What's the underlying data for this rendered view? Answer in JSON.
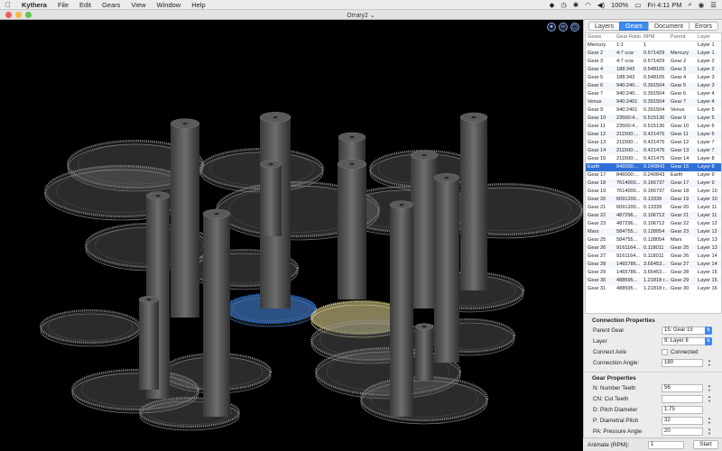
{
  "menubar": {
    "app": "Kythera",
    "items": [
      "File",
      "Edit",
      "Gears",
      "View",
      "Window",
      "Help"
    ],
    "battery": "100%",
    "clock": "Fri 4:11 PM"
  },
  "window": {
    "title": "Orrary2 ⌄"
  },
  "tabs": [
    "Layers",
    "Gears",
    "Document",
    "Errors"
  ],
  "active_tab": "Gears",
  "table": {
    "headers": [
      "Gears",
      "Gear Ratio",
      "RPM",
      "Parent",
      "Layer"
    ],
    "rows": [
      [
        "Mercury",
        "1:1",
        "1",
        "",
        "Layer 1"
      ],
      [
        "Gear 2",
        "4:7 ccw",
        "0.571429",
        "Mercury",
        "Layer 1"
      ],
      [
        "Gear 3",
        "4:7 ccw",
        "0.571429",
        "Gear 2",
        "Layer 2"
      ],
      [
        "Gear 4",
        "188:343",
        "0.548105",
        "Gear 3",
        "Layer 2"
      ],
      [
        "Gear 5",
        "188:343",
        "0.548105",
        "Gear 4",
        "Layer 3"
      ],
      [
        "Gear 6",
        "940:240...",
        "0.391504",
        "Gear 5",
        "Layer 3"
      ],
      [
        "Gear 7",
        "940:240...",
        "0.391504",
        "Gear 6",
        "Layer 4"
      ],
      [
        "Venus",
        "940:2401",
        "0.391504",
        "Gear 7",
        "Layer 4"
      ],
      [
        "Gear 9",
        "940:2401",
        "0.391504",
        "Venus",
        "Layer 5"
      ],
      [
        "Gear 10",
        "23500:4...",
        "0.515136",
        "Gear 9",
        "Layer 5"
      ],
      [
        "Gear 11",
        "23500:4...",
        "0.515136",
        "Gear 10",
        "Layer 6"
      ],
      [
        "Gear 12",
        "211500:...",
        "0.421475",
        "Gear 11",
        "Layer 6"
      ],
      [
        "Gear 13",
        "211500:...",
        "0.421475",
        "Gear 12",
        "Layer 7"
      ],
      [
        "Gear 14",
        "211500:...",
        "0.421475",
        "Gear 13",
        "Layer 7"
      ],
      [
        "Gear 15",
        "211500:...",
        "0.421475",
        "Gear 14",
        "Layer 8"
      ],
      [
        "Earth",
        "846000:...",
        "0.240843",
        "Gear 15",
        "Layer 8"
      ],
      [
        "Gear 17",
        "846000:...",
        "0.240843",
        "Earth",
        "Layer 9"
      ],
      [
        "Gear 18",
        "7614000...",
        "0.166737",
        "Gear 17",
        "Layer 9"
      ],
      [
        "Gear 19",
        "7614000...",
        "0.166737",
        "Gear 18",
        "Layer 10"
      ],
      [
        "Gear 20",
        "6091200...",
        "0.13339",
        "Gear 19",
        "Layer 10"
      ],
      [
        "Gear 21",
        "6091200...",
        "0.13339",
        "Gear 20",
        "Layer 11"
      ],
      [
        "Gear 22",
        "487296...",
        "0.106712",
        "Gear 21",
        "Layer 11"
      ],
      [
        "Gear 23",
        "487296...",
        "0.106712",
        "Gear 22",
        "Layer 12"
      ],
      [
        "Mars",
        "584755...",
        "0.128054",
        "Gear 23",
        "Layer 12"
      ],
      [
        "Gear 25",
        "584755...",
        "0.128054",
        "Mars",
        "Layer 13"
      ],
      [
        "Gear 26",
        "9161164...",
        "0.118011",
        "Gear 25",
        "Layer 13"
      ],
      [
        "Gear 27",
        "9161164...",
        "0.118011",
        "Gear 26",
        "Layer 14"
      ],
      [
        "Gear 28",
        "1465786...",
        "3.65453...",
        "Gear 27",
        "Layer 14"
      ],
      [
        "Gear 29",
        "1465786...",
        "3.65453...",
        "Gear 28",
        "Layer 15"
      ],
      [
        "Gear 30",
        "488595...",
        "1.21818 r...",
        "Gear 29",
        "Layer 15"
      ],
      [
        "Gear 31",
        "488595...",
        "1.21818 r...",
        "Gear 30",
        "Layer 16"
      ]
    ],
    "selected_row": 15
  },
  "connection": {
    "title": "Connection Properties",
    "parent_gear_label": "Parent Gear",
    "parent_gear_value": "15: Gear 15",
    "layer_label": "Layer",
    "layer_value": "9: Layer 8",
    "connect_axle_label": "Connect Axle",
    "connected_label": "Connected",
    "angle_label": "Connection Angle:",
    "angle_value": "180"
  },
  "gear": {
    "title": "Gear Properties",
    "teeth_label": "N: Number Teeth",
    "teeth_value": "56",
    "cut_teeth_label": "CN: Cut Teeth",
    "cut_teeth_value": "",
    "pitch_diameter_label": "D: Pitch Diameter",
    "pitch_diameter_value": "1.75",
    "diametral_pitch_label": "P: Diametral Pitch",
    "diametral_pitch_value": "32",
    "pressure_angle_label": "PA: Pressure Angle",
    "pressure_angle_value": "20"
  },
  "animate": {
    "label": "Animate (RPM):",
    "value": "1",
    "start_label": "Start"
  },
  "colors": {
    "selection": "#2f6fd6",
    "accent": "#3c8bf5",
    "highlight_gear_blue": "#3a7ad1",
    "highlight_gear_yellow": "#e0d48a"
  }
}
